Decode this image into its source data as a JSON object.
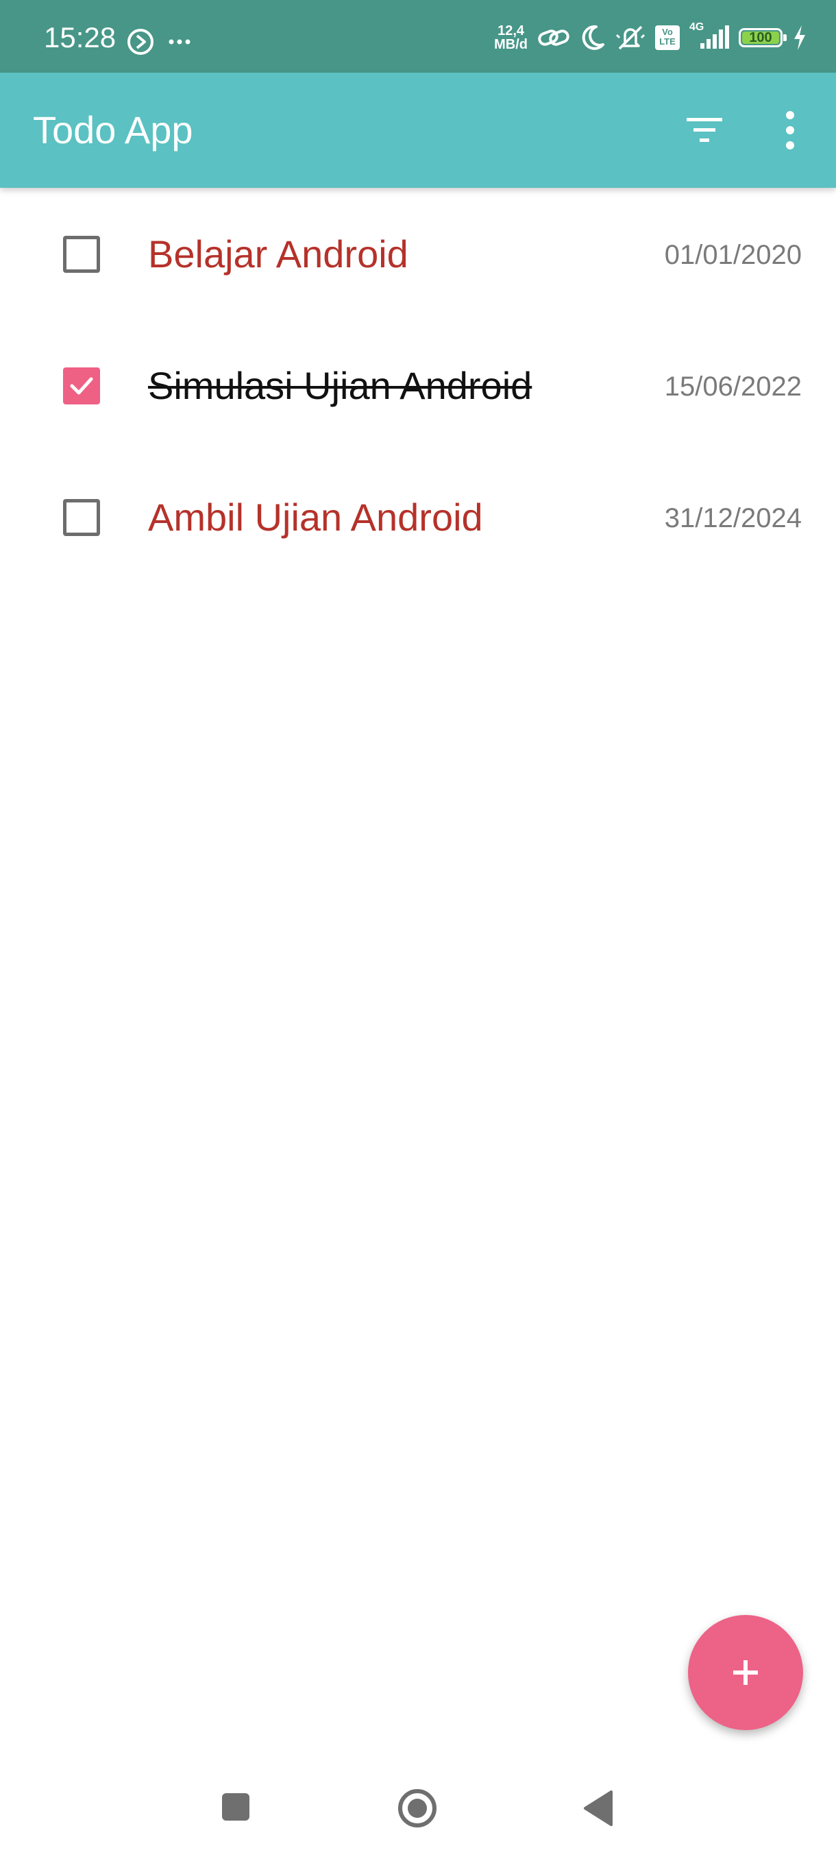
{
  "status_bar": {
    "time": "15:28",
    "netspeed_value": "12,4",
    "netspeed_unit": "MB/d",
    "network_type": "4G",
    "volte": "Vo LTE",
    "battery_level": "100",
    "icons": [
      "play-circle-icon",
      "more-dots-icon",
      "link-icon",
      "moon-icon",
      "mute-icon",
      "volte-icon",
      "signal-icon",
      "battery-icon",
      "charging-icon"
    ]
  },
  "app_bar": {
    "title": "Todo App",
    "background": "#5bc1c2",
    "icons": [
      "filter-icon",
      "overflow-menu-icon"
    ]
  },
  "todos": [
    {
      "title": "Belajar Android",
      "date": "01/01/2020",
      "completed": false
    },
    {
      "title": "Simulasi Ujian Android",
      "date": "15/06/2022",
      "completed": true
    },
    {
      "title": "Ambil Ujian Android",
      "date": "31/12/2024",
      "completed": false
    }
  ],
  "fab": {
    "icon": "plus-icon",
    "color": "#ed6287"
  },
  "nav_bar": {
    "icons": [
      "recents-square-icon",
      "home-circle-icon",
      "back-triangle-icon"
    ]
  },
  "colors": {
    "status_bar": "#479687",
    "active_title": "#b5322a",
    "checked_box": "#ef6085",
    "date_text": "#7a7a7a"
  }
}
